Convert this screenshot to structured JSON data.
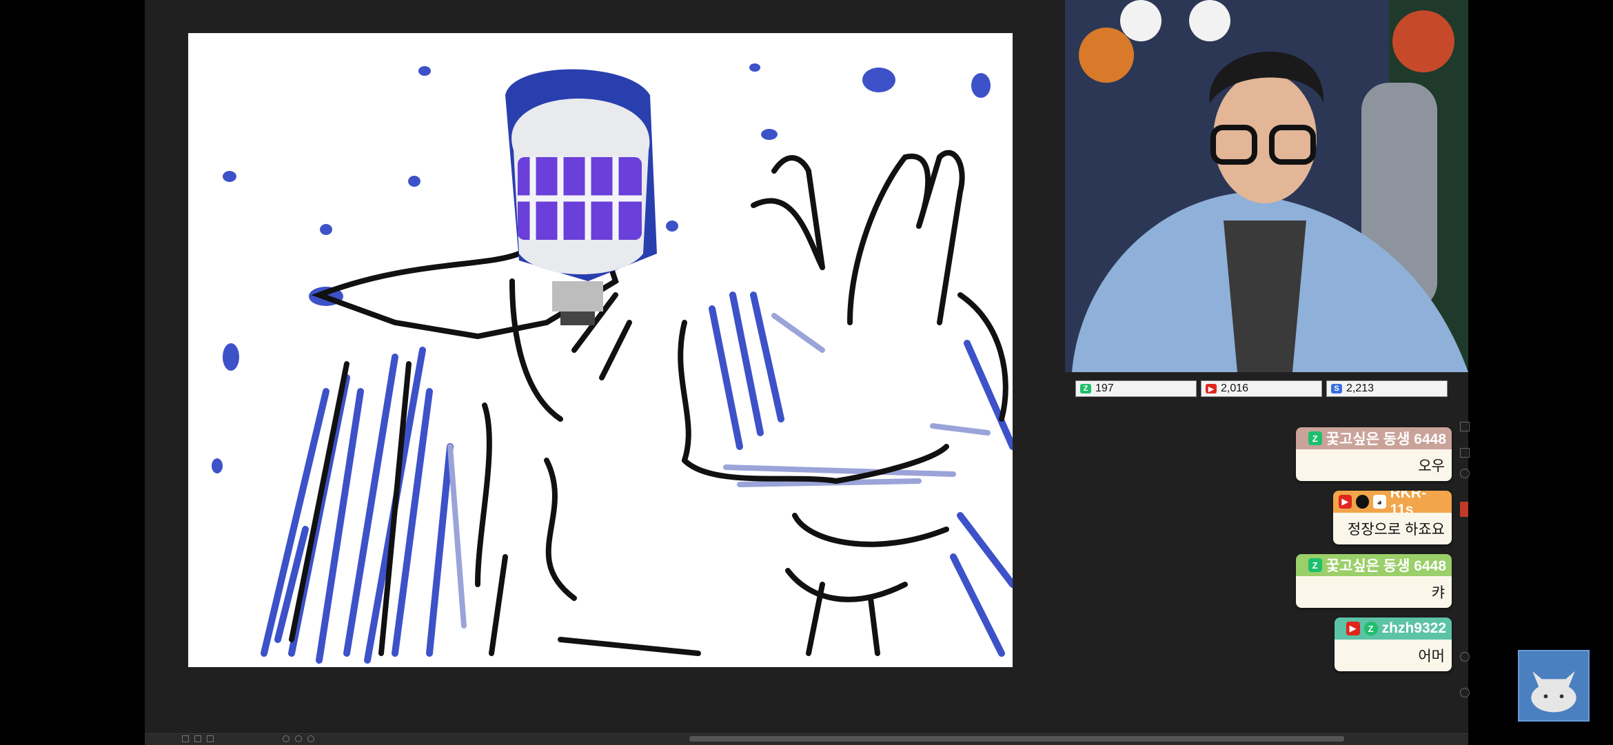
{
  "stats": {
    "chzzk": {
      "icon": "chzzk-icon",
      "value": "197"
    },
    "youtube": {
      "icon": "youtube-icon",
      "value": "2,016"
    },
    "soop": {
      "icon": "soop-icon",
      "value": "2,213"
    }
  },
  "chat": [
    {
      "platforms": [
        "chzzk"
      ],
      "user": "꿏고싶은 동생 6448",
      "text": "오우",
      "head_color": "#c9a39a"
    },
    {
      "platforms": [
        "youtube",
        "circle",
        "bunny"
      ],
      "user": "RKR-11s",
      "text": "정장으로 하죠요",
      "head_color": "#f2a54a"
    },
    {
      "platforms": [
        "chzzk"
      ],
      "user": "꿏고싶은 동생 6448",
      "text": "캬",
      "head_color": "#9bcf6a"
    },
    {
      "platforms": [
        "youtube",
        "chzzk"
      ],
      "user": "zhzh9322",
      "text": "어머",
      "head_color": "#5cc3a6"
    }
  ],
  "colors": {
    "chzzk": "#1fbf6c",
    "youtube": "#e0261d",
    "soop": "#3b6fe0",
    "brush_blue": "#3d52c8"
  }
}
